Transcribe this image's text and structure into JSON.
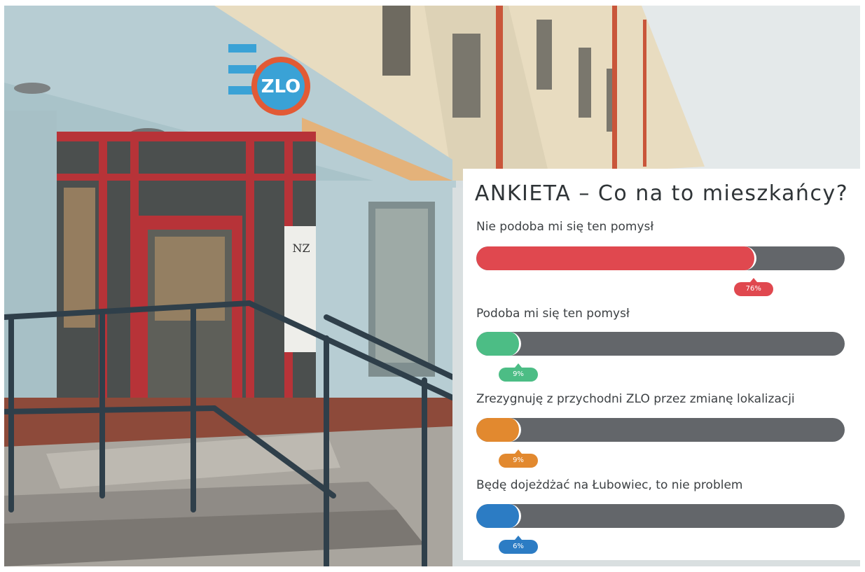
{
  "poll": {
    "title": "ANKIETA – Co na to mieszkańcy?",
    "track_color": "#63666a",
    "options": [
      {
        "label": "Nie podoba mi się ten pomysł",
        "percent": 76,
        "percent_label": "76%",
        "color": "#e0484f"
      },
      {
        "label": "Podoba mi się ten pomysł",
        "percent": 9,
        "percent_label": "9%",
        "color": "#4cbd85"
      },
      {
        "label": "Zrezygnuję z przychodni ZLO przez zmianę lokalizacji",
        "percent": 9,
        "percent_label": "9%",
        "color": "#e2892f"
      },
      {
        "label": "Będę dojeżdżać na Łubowiec, to nie problem",
        "percent": 6,
        "percent_label": "6%",
        "color": "#2c7cc4"
      }
    ]
  },
  "chart_data": {
    "type": "bar",
    "title": "ANKIETA – Co na to mieszkańcy?",
    "categories": [
      "Nie podoba mi się ten pomysł",
      "Podoba mi się ten pomysł",
      "Zrezygnuję z przychodni ZLO przez zmianę lokalizacji",
      "Będę dojeżdżać na Łubowiec, to nie problem"
    ],
    "values": [
      76,
      9,
      9,
      6
    ],
    "ylim": [
      0,
      100
    ],
    "orientation": "horizontal",
    "grid": false
  },
  "photo": {
    "sign_text": "ZLO",
    "door_sign_text": "NZ"
  }
}
